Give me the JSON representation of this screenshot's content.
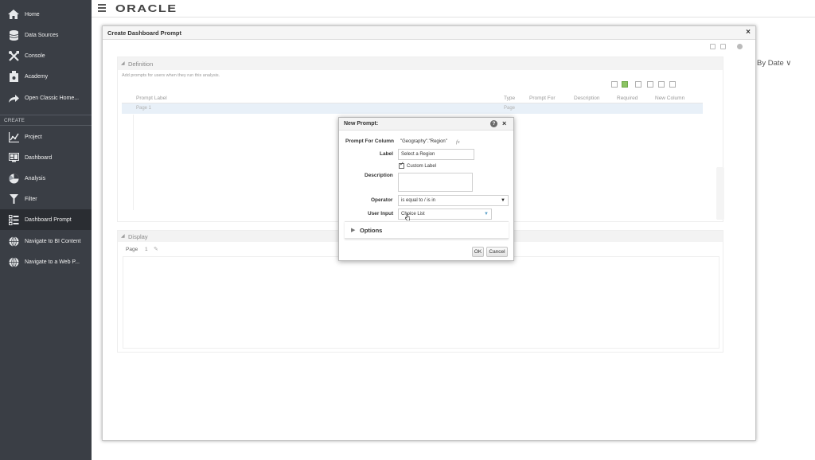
{
  "sidebar": {
    "items": [
      {
        "label": "Home",
        "icon": "home-icon"
      },
      {
        "label": "Data Sources",
        "icon": "database-icon"
      },
      {
        "label": "Console",
        "icon": "tools-icon"
      },
      {
        "label": "Academy",
        "icon": "academy-icon"
      },
      {
        "label": "Open Classic Home...",
        "icon": "arrow-icon"
      }
    ],
    "create_section": "CREATE",
    "create_items": [
      {
        "label": "Project",
        "icon": "project-icon"
      },
      {
        "label": "Dashboard",
        "icon": "dashboard-icon"
      },
      {
        "label": "Analysis",
        "icon": "analysis-icon"
      },
      {
        "label": "Filter",
        "icon": "filter-icon"
      },
      {
        "label": "Dashboard Prompt",
        "icon": "prompt-icon",
        "active": true
      },
      {
        "label": "Navigate to BI Content",
        "icon": "globe-icon"
      },
      {
        "label": "Navigate to a Web P...",
        "icon": "globe-icon"
      }
    ]
  },
  "topbar": {
    "logo": "ORACLE"
  },
  "sort_by": "By Date ∨",
  "dashboard_dialog": {
    "title": "Create Dashboard Prompt",
    "close": "×",
    "definition": {
      "title": "Definition",
      "hint": "Add prompts for users when they run this analysis.",
      "columns": [
        "Prompt Label",
        "Type",
        "Prompt For",
        "Description",
        "Required",
        "New Column"
      ],
      "row": {
        "label": "Page 1",
        "type": "Page"
      }
    },
    "display": {
      "title": "Display",
      "page_label": "Page",
      "page_number": "1"
    }
  },
  "prompt_dialog": {
    "title": "New Prompt:",
    "help": "?",
    "close": "×",
    "prompt_for_column_label": "Prompt For Column",
    "prompt_for_column_value": "\"Geography\".\"Region\"",
    "fx": "fx",
    "label_label": "Label",
    "label_value": "Select a Region",
    "custom_label": "Custom Label",
    "custom_label_checked": true,
    "description_label": "Description",
    "operator_label": "Operator",
    "operator_value": "is equal to / is in",
    "user_input_label": "User Input",
    "user_input_value": "Choice List",
    "options": "Options",
    "ok": "OK",
    "cancel": "Cancel"
  }
}
